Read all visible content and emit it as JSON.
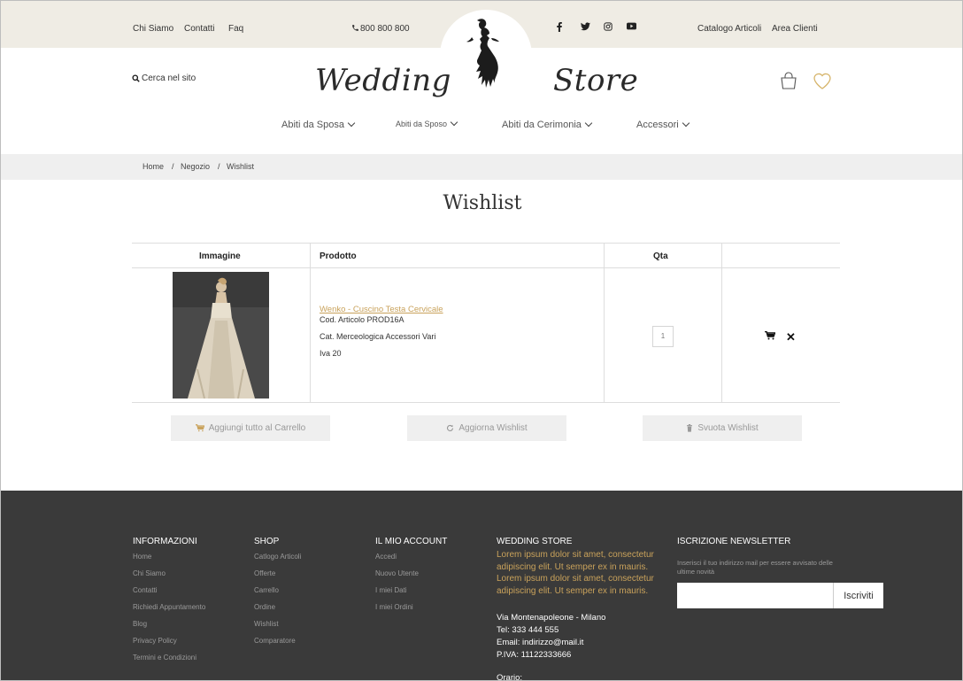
{
  "topbar": {
    "links_left": [
      "Chi Siamo",
      "Contatti",
      "Faq"
    ],
    "phone": "800 800 800",
    "links_right": [
      "Catalogo Articoli",
      "Area Clienti"
    ],
    "social_icons": [
      "facebook-icon",
      "twitter-icon",
      "instagram-icon",
      "youtube-icon"
    ]
  },
  "header": {
    "search_label": "Cerca nel sito",
    "brand_left": "Wedding",
    "brand_right": "Store"
  },
  "nav": {
    "items": [
      "Abiti da Sposa",
      "Abiti da Sposo",
      "Abiti da Cerimonia",
      "Accessori"
    ]
  },
  "breadcrumb": {
    "items": [
      "Home",
      "Negozio",
      "Wishlist"
    ],
    "separator": "/"
  },
  "page_title": "Wishlist",
  "table": {
    "headers": [
      "Immagine",
      "Prodotto",
      "Qta",
      ""
    ],
    "rows": [
      {
        "product_name": "Wenko - Cuscino Testa Cervicale",
        "code": "Cod. Articolo PROD16A",
        "category": "Cat. Merceologica Accessori Vari",
        "vat": "Iva 20",
        "quantity": "1"
      }
    ]
  },
  "actions": {
    "add_all": "Aggiungi tutto al Carrello",
    "update": "Aggiorna Wishlist",
    "empty": "Svuota Wishlist"
  },
  "footer": {
    "info": {
      "title": "INFORMAZIONI",
      "links": [
        "Home",
        "Chi Siamo",
        "Contatti",
        "Richiedi Appuntamento",
        "Blog",
        "Privacy Policy",
        "Termini e Condizioni"
      ]
    },
    "shop": {
      "title": "SHOP",
      "links": [
        "Catlogo Articoli",
        "Offerte",
        "Carrello",
        "Ordine",
        "Wishlist",
        "Comparatore"
      ]
    },
    "account": {
      "title": "IL MIO ACCOUNT",
      "links": [
        "Accedi",
        "Nuovo Utente",
        "I miei Dati",
        "I miei Ordini"
      ]
    },
    "store": {
      "title": "WEDDING STORE",
      "description": "Lorem ipsum dolor sit amet, consectetur adipiscing elit. Ut semper ex in mauris. Lorem ipsum dolor sit amet, consectetur adipiscing elit. Ut semper ex in mauris.",
      "address": "Via Montenapoleone - Milano",
      "phone": "Tel:  333 444 555",
      "email": "Email: indirizzo@mail.it",
      "vat": "P.IVA: 11122333666",
      "hours_label": "Orario:"
    },
    "newsletter": {
      "title": "ISCRIZIONE NEWSLETTER",
      "text": "Inserisci il tuo indirizzo mail per essere avvisato delle ultime novità",
      "button": "Iscriviti",
      "input_placeholder": ""
    }
  },
  "colors": {
    "topbar_bg": "#efece4",
    "accent_gold": "#c9a25b",
    "footer_bg": "#3a3a3a",
    "button_bg": "#efefef"
  }
}
